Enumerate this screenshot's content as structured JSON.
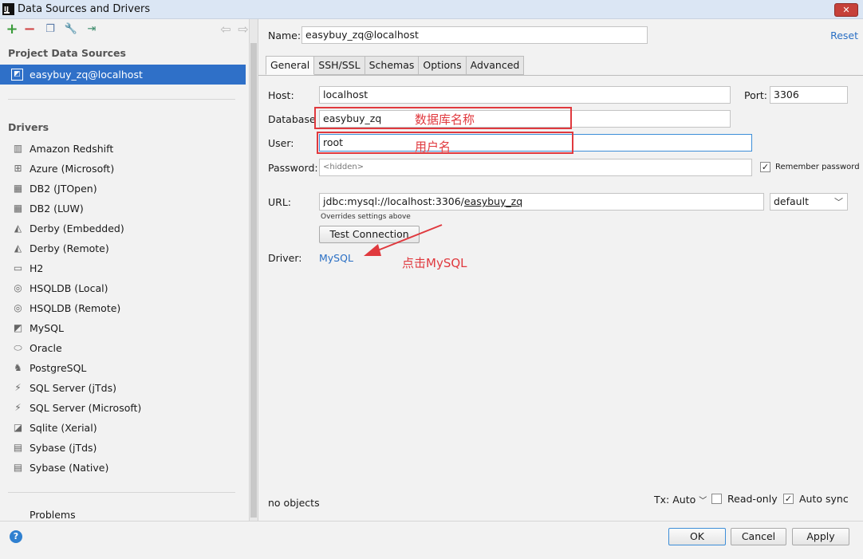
{
  "window": {
    "title": "Data Sources and Drivers",
    "close_label": "✕"
  },
  "toolbar": {
    "add": "+",
    "remove": "−",
    "back": "⇦",
    "forward": "⇨"
  },
  "sidebar": {
    "project_title": "Project Data Sources",
    "selected_source": "easybuy_zq@localhost",
    "drivers_title": "Drivers",
    "drivers": [
      {
        "label": "Amazon Redshift",
        "icon": "redshift-icon",
        "glyph": "▥"
      },
      {
        "label": "Azure (Microsoft)",
        "icon": "azure-icon",
        "glyph": "⊞"
      },
      {
        "label": "DB2 (JTOpen)",
        "icon": "db2-icon",
        "glyph": "▦"
      },
      {
        "label": "DB2 (LUW)",
        "icon": "db2-icon",
        "glyph": "▦"
      },
      {
        "label": "Derby (Embedded)",
        "icon": "derby-hat-icon",
        "glyph": "◭"
      },
      {
        "label": "Derby (Remote)",
        "icon": "derby-hat-icon",
        "glyph": "◭"
      },
      {
        "label": "H2",
        "icon": "h2-icon",
        "glyph": "▭"
      },
      {
        "label": "HSQLDB (Local)",
        "icon": "hsqldb-icon",
        "glyph": "◎"
      },
      {
        "label": "HSQLDB (Remote)",
        "icon": "hsqldb-icon",
        "glyph": "◎"
      },
      {
        "label": "MySQL",
        "icon": "mysql-icon",
        "glyph": "◩"
      },
      {
        "label": "Oracle",
        "icon": "oracle-icon",
        "glyph": "⬭"
      },
      {
        "label": "PostgreSQL",
        "icon": "postgresql-icon",
        "glyph": "♞"
      },
      {
        "label": "SQL Server (jTds)",
        "icon": "sqlserver-icon",
        "glyph": "⚡"
      },
      {
        "label": "SQL Server (Microsoft)",
        "icon": "sqlserver-icon",
        "glyph": "⚡"
      },
      {
        "label": "Sqlite (Xerial)",
        "icon": "sqlite-icon",
        "glyph": "◪"
      },
      {
        "label": "Sybase (jTds)",
        "icon": "sybase-icon",
        "glyph": "▤"
      },
      {
        "label": "Sybase (Native)",
        "icon": "sybase-icon",
        "glyph": "▤"
      }
    ],
    "problems": "Problems"
  },
  "form": {
    "name_label": "Name:",
    "name_value": "easybuy_zq@localhost",
    "reset": "Reset",
    "tabs": [
      "General",
      "SSH/SSL",
      "Schemas",
      "Options",
      "Advanced"
    ],
    "host_label": "Host:",
    "host_value": "localhost",
    "port_label": "Port:",
    "port_value": "3306",
    "database_label": "Database",
    "database_value": "easybuy_zq",
    "user_label": "User:",
    "user_value": "root",
    "password_label": "Password:",
    "password_value": "<hidden>",
    "remember_password": "Remember password",
    "url_label": "URL:",
    "url_prefix": "jdbc:mysql://localhost:3306/",
    "url_db": "easybuy_zq",
    "url_mode": "default",
    "overrides_note": "Overrides settings above",
    "test_connection": "Test Connection",
    "driver_label": "Driver:",
    "driver_value": "MySQL",
    "no_objects": "no objects",
    "tx": "Tx: Auto",
    "read_only": "Read-only",
    "auto_sync": "Auto sync"
  },
  "annotations": {
    "database_note": "数据库名称",
    "user_note": "用户名",
    "click_note": "点击MySQL",
    "color": "#e0393e"
  },
  "buttons": {
    "ok": "OK",
    "cancel": "Cancel",
    "apply": "Apply",
    "help": "?"
  }
}
